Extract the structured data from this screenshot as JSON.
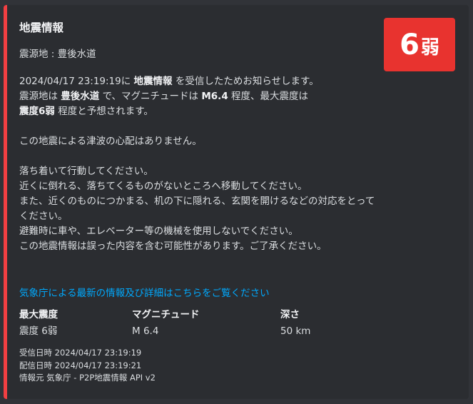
{
  "embed": {
    "accent_color": "#f23f42",
    "title": "地震情報",
    "subtitle": "震源地 : 豊後水道",
    "badge": {
      "number": "6",
      "level": "弱",
      "color": "#e8332f"
    },
    "description": {
      "p1": {
        "datetime": "2024/04/17 23:19:19に",
        "info_type": "地震情報",
        "after_info": "を受信したためお知らせします。",
        "epicenter_pre": "震源地は",
        "epicenter": "豊後水道",
        "epicenter_post": "で、マグニチュードは",
        "magnitude": "M6.4",
        "magnitude_post": "程度、最大震度は",
        "intensity": "震度6弱",
        "intensity_post": "程度と予想されます。"
      },
      "tsunami": "この地震による津波の心配はありません。",
      "advice": [
        "落ち着いて行動してください。",
        "近くに倒れる、落ちてくるものがないところへ移動してください。",
        "また、近くのものにつかまる、机の下に隠れる、玄関を開けるなどの対応をとってください。",
        "避難時に車や、エレベーター等の機械を使用しないでください。",
        "この地震情報は誤った内容を含む可能性があります。ご了承ください。"
      ]
    },
    "link_text": "気象庁による最新の情報及び詳細はこちらをご覧ください",
    "fields": [
      {
        "name": "最大震度",
        "value": "震度 6弱"
      },
      {
        "name": "マグニチュード",
        "value": "M 6.4"
      },
      {
        "name": "深さ",
        "value": "50 km"
      }
    ],
    "footer": {
      "received": "受信日時 2024/04/17 23:19:19",
      "delivered": "配信日時 2024/04/17 23:19:21",
      "source": "情報元 気象庁 - P2P地震情報 API v2"
    }
  }
}
